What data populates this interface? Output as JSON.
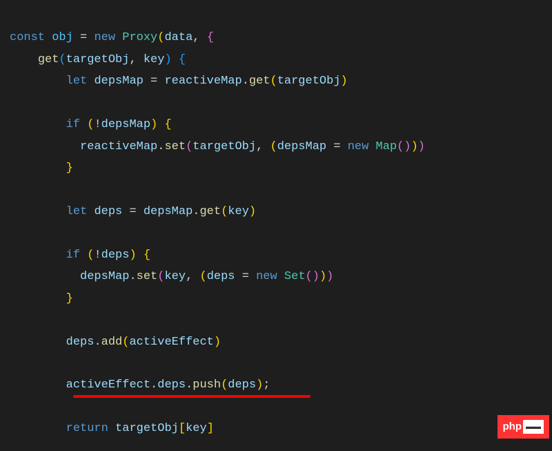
{
  "code": {
    "line1": {
      "kw_const": "const",
      "obj": "obj",
      "eq": " = ",
      "kw_new": "new",
      "proxy": "Proxy",
      "data": "data"
    },
    "line2": {
      "get": "get",
      "p1": "targetObj",
      "p2": "key"
    },
    "line3": {
      "kw_let": "let",
      "depsMap": "depsMap",
      "eq": " = ",
      "reactiveMap": "reactiveMap",
      "get": "get",
      "targetObj": "targetObj"
    },
    "line5": {
      "kw_if": "if",
      "excl": "!",
      "depsMap": "depsMap"
    },
    "line6": {
      "reactiveMap": "reactiveMap",
      "set": "set",
      "targetObj": "targetObj",
      "depsMap": "depsMap",
      "kw_new": "new",
      "Map": "Map"
    },
    "line9": {
      "kw_let": "let",
      "deps": "deps",
      "eq": " = ",
      "depsMap": "depsMap",
      "get": "get",
      "key": "key"
    },
    "line11": {
      "kw_if": "if",
      "excl": "!",
      "deps": "deps"
    },
    "line12": {
      "depsMap": "depsMap",
      "set": "set",
      "key": "key",
      "deps": "deps",
      "kw_new": "new",
      "Set": "Set"
    },
    "line15": {
      "deps": "deps",
      "add": "add",
      "activeEffect": "activeEffect"
    },
    "line17": {
      "activeEffect": "activeEffect",
      "deps": "deps",
      "push": "push",
      "depsArg": "deps"
    },
    "line19": {
      "kw_return": "return",
      "targetObj": "targetObj",
      "key": "key"
    }
  },
  "watermark": {
    "text": "php",
    "suffix": "▬▬"
  }
}
